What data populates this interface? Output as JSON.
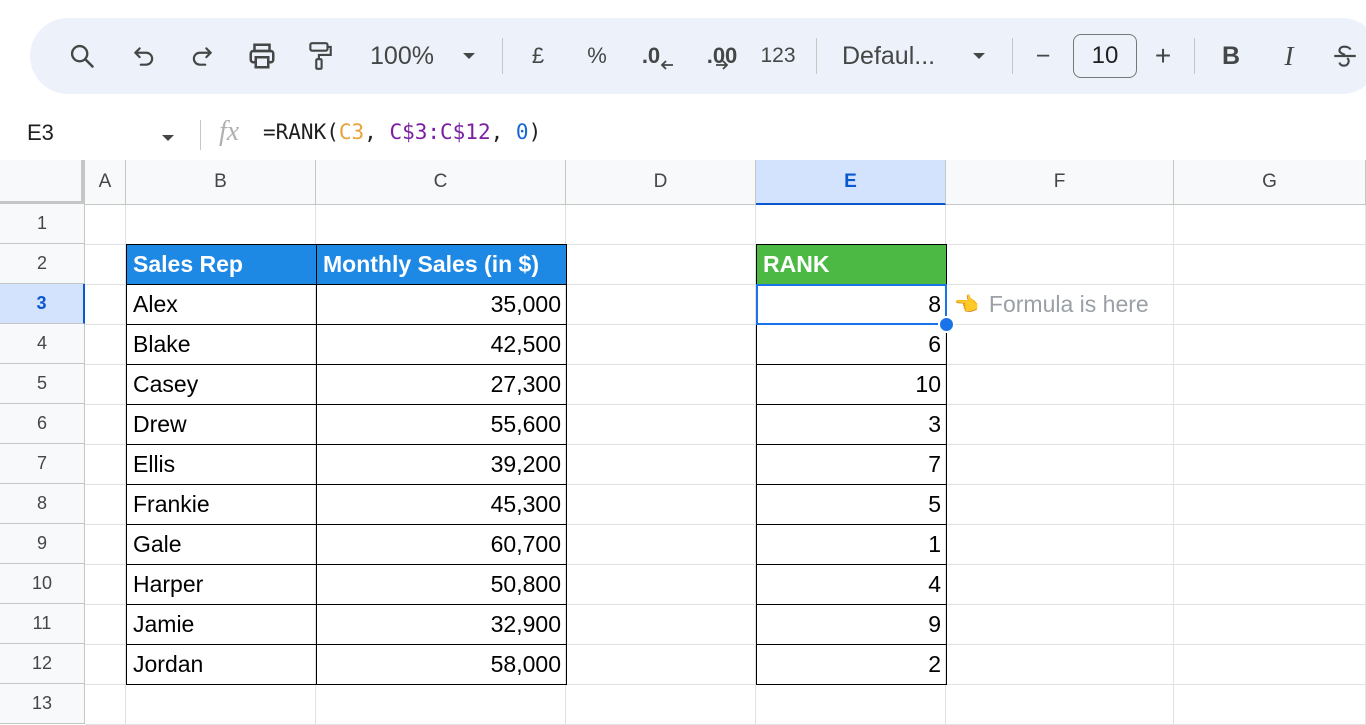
{
  "toolbar": {
    "zoom": "100%",
    "currency_label": "£",
    "percent_label": "%",
    "decrease_decimal_label": ".0",
    "increase_decimal_label": ".00",
    "number_format_label": "123",
    "font_name": "Defaul...",
    "font_size": "10",
    "minus_label": "−",
    "plus_label": "+",
    "bold_label": "B",
    "italic_label": "I",
    "icons": [
      "search-icon",
      "undo-icon",
      "redo-icon",
      "print-icon",
      "paint-format-icon",
      "chevron-down-icon",
      "decrease-decimal-icon",
      "increase-decimal-icon",
      "strikethrough-icon"
    ]
  },
  "formula_bar": {
    "cell_ref": "E3",
    "fx_label": "fx",
    "formula_prefix": "=RANK(",
    "formula_arg1": "C3",
    "formula_sep1": ", ",
    "formula_arg2": "C$3:C$12",
    "formula_sep2": ", ",
    "formula_arg3": "0",
    "formula_suffix": ")"
  },
  "columns": [
    "A",
    "B",
    "C",
    "D",
    "E",
    "F",
    "G"
  ],
  "selected_column": "E",
  "rows": [
    "1",
    "2",
    "3",
    "4",
    "5",
    "6",
    "7",
    "8",
    "9",
    "10",
    "11",
    "12",
    "13"
  ],
  "selected_row": "3",
  "table": {
    "header_rep": "Sales Rep",
    "header_sales": "Monthly Sales (in $)",
    "header_rank": "RANK",
    "header_blue": "#1e88e5",
    "header_green": "#4cb944",
    "records": [
      {
        "rep": "Alex",
        "sales": "35,000",
        "rank": "8"
      },
      {
        "rep": "Blake",
        "sales": "42,500",
        "rank": "6"
      },
      {
        "rep": "Casey",
        "sales": "27,300",
        "rank": "10"
      },
      {
        "rep": "Drew",
        "sales": "55,600",
        "rank": "3"
      },
      {
        "rep": "Ellis",
        "sales": "39,200",
        "rank": "7"
      },
      {
        "rep": "Frankie",
        "sales": "45,300",
        "rank": "5"
      },
      {
        "rep": "Gale",
        "sales": "60,700",
        "rank": "1"
      },
      {
        "rep": "Harper",
        "sales": "50,800",
        "rank": "4"
      },
      {
        "rep": "Jamie",
        "sales": "32,900",
        "rank": "9"
      },
      {
        "rep": "Jordan",
        "sales": "58,000",
        "rank": "2"
      }
    ]
  },
  "annotation": {
    "icon": "pointing-hand-icon",
    "text": "Formula is here"
  }
}
